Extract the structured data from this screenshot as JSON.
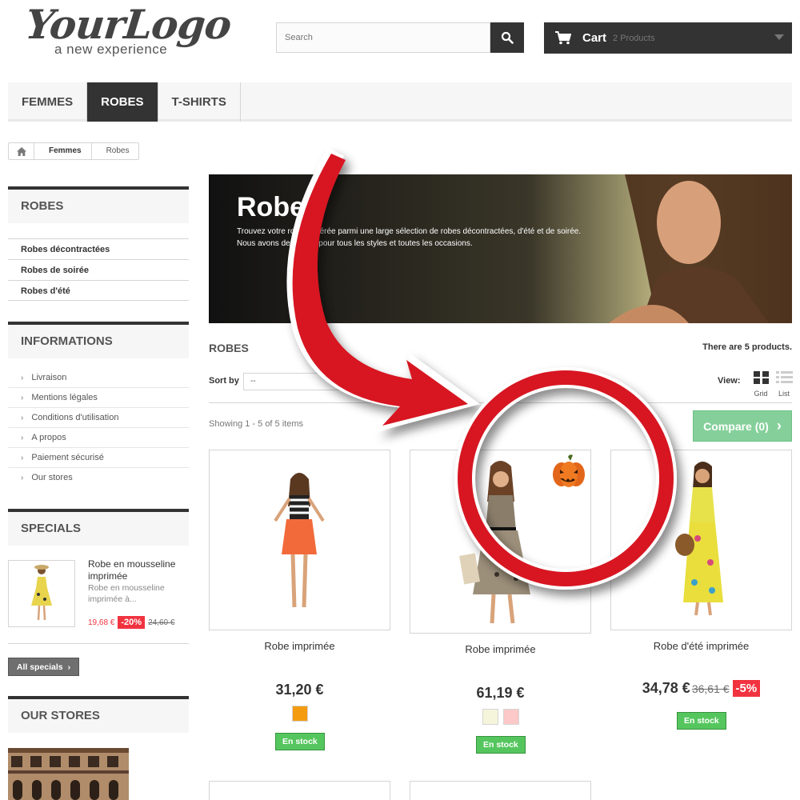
{
  "header": {
    "logo_main": "YourLogo",
    "logo_sub": "a new experience",
    "search_placeholder": "Search",
    "cart_label": "Cart",
    "cart_count": "2 Products"
  },
  "menu": {
    "items": [
      "FEMMES",
      "ROBES",
      "T-SHIRTS"
    ],
    "active": "ROBES"
  },
  "breadcrumb": {
    "items": [
      "Femmes",
      "Robes"
    ]
  },
  "sidebar": {
    "categories_title": "ROBES",
    "categories": [
      "Robes décontractées",
      "Robes de soirée",
      "Robes d'été"
    ],
    "info_title": "INFORMATIONS",
    "info_items": [
      "Livraison",
      "Mentions légales",
      "Conditions d'utilisation",
      "A propos",
      "Paiement sécurisé",
      "Our stores"
    ],
    "specials_title": "SPECIALS",
    "special": {
      "name": "Robe en mousseline imprimée",
      "desc": "Robe en mousseline imprimée à...",
      "price": "19,68 €",
      "discount": "-20%",
      "old_price": "24,60 €"
    },
    "all_specials": "All specials",
    "stores_title": "OUR STORES"
  },
  "banner": {
    "title": "Robes",
    "text_line1": "Trouvez votre robe préférée parmi une large sélection de robes décontractées, d'été et de soirée.",
    "text_line2": "Nous avons des robes pour tous les styles et toutes les occasions."
  },
  "category": {
    "heading": "ROBES",
    "count_text": "There are 5 products.",
    "sort_label": "Sort by",
    "sort_value": "--",
    "view_label": "View:",
    "view_grid": "Grid",
    "view_list": "List",
    "showing": "Showing 1 - 5 of 5 items",
    "compare": "Compare (0)"
  },
  "products": [
    {
      "name": "Robe imprimée",
      "price": "31,20 €",
      "old_price": "",
      "discount": "",
      "stock": "En stock",
      "swatches": [
        "#f39c11"
      ]
    },
    {
      "name": "Robe imprimée",
      "price": "61,19 €",
      "old_price": "",
      "discount": "",
      "stock": "En stock",
      "swatches": [
        "#f5f5dc",
        "#fcc8c8"
      ]
    },
    {
      "name": "Robe d'été imprimée",
      "price": "34,78 €",
      "old_price": "36,61 €",
      "discount": "-5%",
      "stock": "En stock",
      "swatches": []
    }
  ],
  "colors": {
    "dark": "#333333",
    "accent_red": "#f13340",
    "stock_green": "#55c65e",
    "compare_green": "#85d09a",
    "annotation_red": "#d71920"
  },
  "icons": [
    "search-icon",
    "cart-icon",
    "home-icon",
    "grid-icon",
    "list-icon",
    "chevron-right-icon",
    "pumpkin-icon"
  ]
}
